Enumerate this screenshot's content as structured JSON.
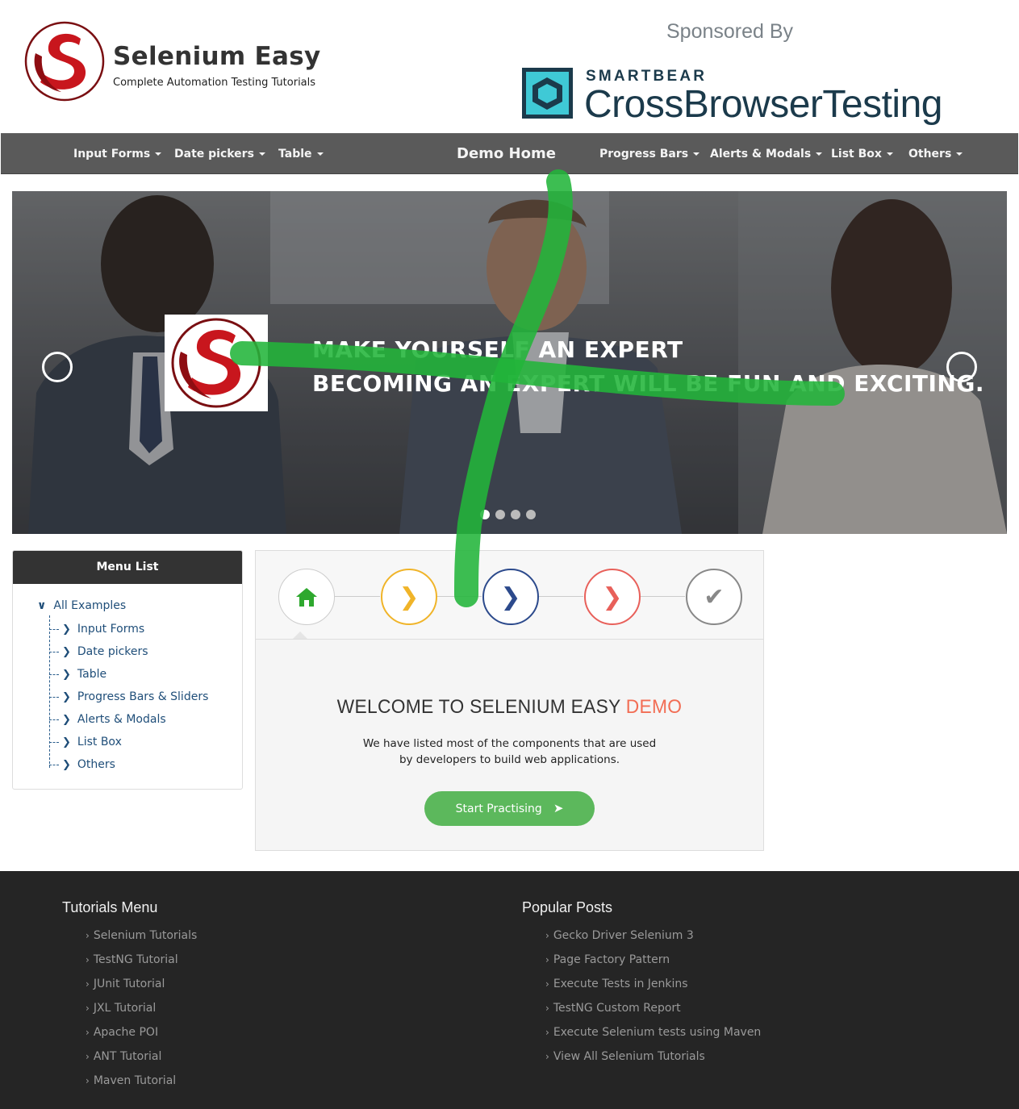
{
  "header": {
    "brand_title": "Selenium Easy",
    "brand_subtitle": "Complete Automation Testing Tutorials",
    "sponsored_label": "Sponsored By",
    "sponsor_company": "SMARTBEAR",
    "sponsor_product": "CrossBrowserTesting"
  },
  "nav": {
    "input_forms": "Input Forms",
    "date_pickers": "Date pickers",
    "table": "Table",
    "demo_home": "Demo Home",
    "progress_bars": "Progress Bars",
    "alerts_modals": "Alerts & Modals",
    "list_box": "List Box",
    "others": "Others"
  },
  "carousel": {
    "line1": "MAKE YOURSELF AN EXPERT",
    "line2": "BECOMING AN EXPERT WILL BE FUN AND EXCITING.",
    "slide_count": 4,
    "active_slide": 1
  },
  "menu": {
    "title": "Menu List",
    "root": "All Examples",
    "items": [
      "Input Forms",
      "Date pickers",
      "Table",
      "Progress Bars & Sliders",
      "Alerts & Modals",
      "List Box",
      "Others"
    ]
  },
  "welcome": {
    "heading_main": "WELCOME TO SELENIUM EASY ",
    "heading_accent": "DEMO",
    "text_line1": "We have listed most of the components that are used",
    "text_line2": "by developers to build web applications.",
    "button_label": "Start Practising"
  },
  "wizard_steps": [
    {
      "icon": "home-icon",
      "color": "#2ea82e"
    },
    {
      "icon": "chevron-right-icon",
      "color": "#f0b429"
    },
    {
      "icon": "chevron-right-icon",
      "color": "#2c4a8c"
    },
    {
      "icon": "chevron-right-icon",
      "color": "#e8605a"
    },
    {
      "icon": "check-icon",
      "color": "#888888"
    }
  ],
  "footer": {
    "tutorials_heading": "Tutorials Menu",
    "tutorials": [
      "Selenium Tutorials",
      "TestNG Tutorial",
      "JUnit Tutorial",
      "JXL Tutorial",
      "Apache POI",
      "ANT Tutorial",
      "Maven Tutorial"
    ],
    "posts_heading": "Popular Posts",
    "posts": [
      "Gecko Driver Selenium 3",
      "Page Factory Pattern",
      "Execute Tests in Jenkins",
      "TestNG Custom Report",
      "Execute Selenium tests using Maven",
      "View All Selenium Tutorials"
    ]
  },
  "colors": {
    "brand_red": "#c8161d",
    "nav_bg": "#5a5a5a",
    "link_blue": "#1f4e79",
    "accent_orange": "#f26d54",
    "button_green": "#5cb85c",
    "footer_bg": "#252525",
    "marker_green": "#22b53a"
  }
}
